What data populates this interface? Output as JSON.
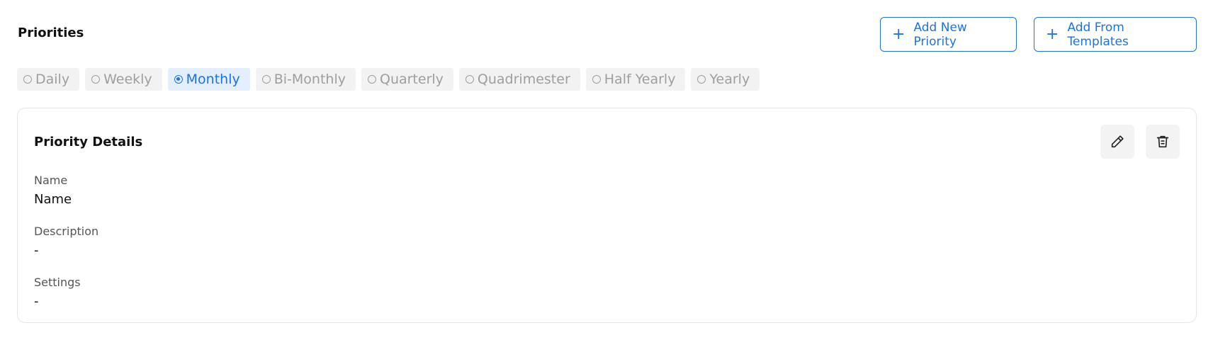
{
  "header": {
    "title": "Priorities",
    "add_new_label": "Add New Priority",
    "add_templates_label": "Add From Templates"
  },
  "frequencies": {
    "selected": "Monthly",
    "options": [
      "Daily",
      "Weekly",
      "Monthly",
      "Bi-Monthly",
      "Quarterly",
      "Quadrimester",
      "Half Yearly",
      "Yearly"
    ]
  },
  "card": {
    "title": "Priority Details",
    "fields": [
      {
        "label": "Name",
        "value": "Name"
      },
      {
        "label": "Description",
        "value": "-"
      },
      {
        "label": "Settings",
        "value": "-"
      }
    ]
  },
  "icons": {
    "add": "plus-icon",
    "edit": "pencil-icon",
    "delete": "trash-icon"
  },
  "colors": {
    "accent": "#1a73e8",
    "selected_bg": "#e3efff",
    "option_bg": "#f2f2f2",
    "option_text": "#9e9e9e"
  }
}
